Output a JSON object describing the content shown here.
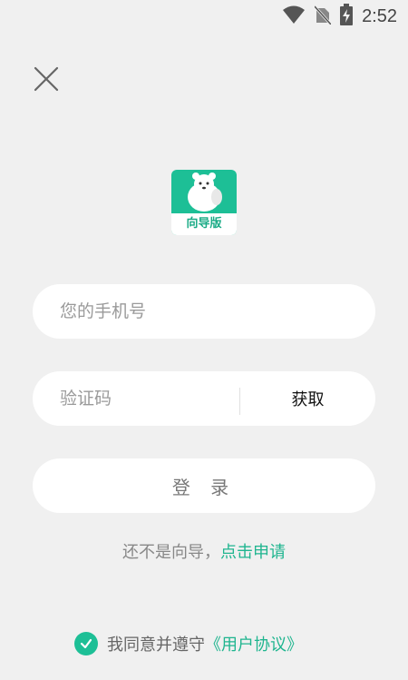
{
  "status_bar": {
    "time": "2:52",
    "icons": [
      "wifi-icon",
      "no-sim-icon",
      "battery-charging-icon"
    ]
  },
  "close_icon": "close-icon",
  "logo": {
    "label": "向导版",
    "colors": {
      "primary": "#1dbf96",
      "band": "#ffffff"
    }
  },
  "phone_field": {
    "placeholder": "您的手机号",
    "value": ""
  },
  "code_field": {
    "placeholder": "验证码",
    "value": ""
  },
  "get_code_label": "获取",
  "login_label": "登 录",
  "apply": {
    "text": "还不是向导，",
    "link": "点击申请"
  },
  "agreement": {
    "checked": true,
    "text": "我同意并遵守",
    "link": "《用户协议》"
  },
  "colors": {
    "accent": "#1fb58f",
    "background": "#f0f0f0",
    "field": "#ffffff"
  }
}
